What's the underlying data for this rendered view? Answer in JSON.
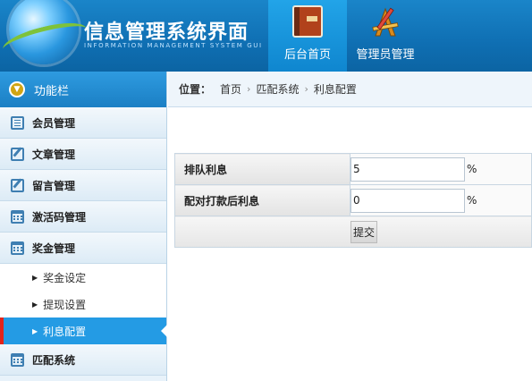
{
  "header": {
    "title": "信息管理系统界面",
    "subtitle": "INFORMATION MANAGEMENT SYSTEM GUI",
    "nav": [
      {
        "label": "后台首页",
        "icon": "book-icon",
        "active": true
      },
      {
        "label": "管理员管理",
        "icon": "pencil-ruler-icon",
        "active": false
      }
    ]
  },
  "sidebar": {
    "title": "功能栏",
    "items": [
      {
        "label": "会员管理",
        "icon": "list-icon"
      },
      {
        "label": "文章管理",
        "icon": "edit-icon"
      },
      {
        "label": "留言管理",
        "icon": "edit-icon"
      },
      {
        "label": "激活码管理",
        "icon": "calendar-icon"
      },
      {
        "label": "奖金管理",
        "icon": "calendar-icon"
      }
    ],
    "sub_items": [
      {
        "label": "奖金设定",
        "active": false
      },
      {
        "label": "提现设置",
        "active": false
      },
      {
        "label": "利息配置",
        "active": true
      }
    ],
    "bottom_item": {
      "label": "匹配系统",
      "icon": "calendar-icon"
    }
  },
  "breadcrumb": {
    "label": "位置：",
    "path": [
      "首页",
      "匹配系统",
      "利息配置"
    ]
  },
  "form": {
    "rows": [
      {
        "label": "排队利息",
        "value": "5",
        "unit": "%"
      },
      {
        "label": "配对打款后利息",
        "value": "0",
        "unit": "%"
      }
    ],
    "submit_label": "提交"
  },
  "colors": {
    "header_bg": "#0f6fb3",
    "active_blue": "#249be4",
    "active_marker": "#e2241b"
  }
}
